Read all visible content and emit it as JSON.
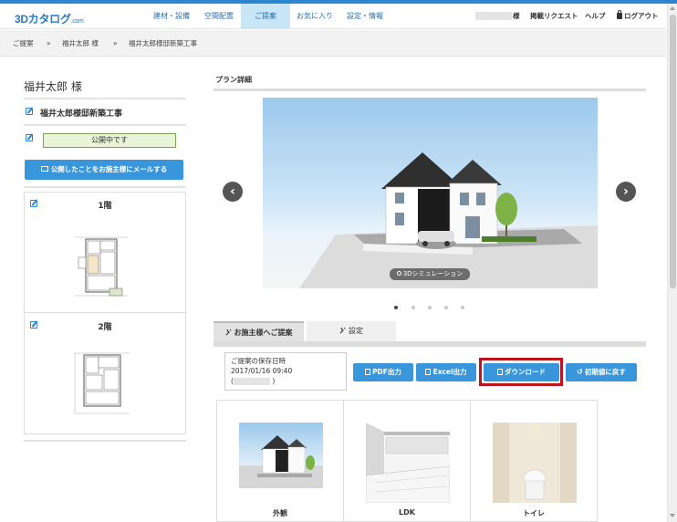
{
  "app": {
    "logo": "3Dカタログ",
    "logo_suffix": ".com"
  },
  "nav": {
    "items": [
      "建材・設備",
      "空間配置",
      "ご提案",
      "お気に入り",
      "設定・情報"
    ],
    "user_suffix": "様",
    "request": "掲載リクエスト",
    "help": "ヘルプ",
    "logout": "ログアウト"
  },
  "breadcrumb": {
    "items": [
      "ご提案",
      "福井太郎 様",
      "福井太郎様邸新築工事"
    ],
    "separator": "»"
  },
  "left": {
    "customer": "福井太郎 様",
    "project": "福井太郎様邸新築工事",
    "status": "公開中です",
    "mail_button": "公開したことをお施主様にメールする",
    "floors": [
      "1階",
      "2階"
    ]
  },
  "plan": {
    "heading": "プラン詳細",
    "sim_button": "3Dシミュレーション",
    "prev": "‹",
    "next": "›",
    "dot_count": 5
  },
  "tabs": {
    "proposal": "お施主様へご提案",
    "settings": "設定"
  },
  "save": {
    "label": "ご提案の保存日時",
    "date": "2017/01/16 09:40",
    "open": "(",
    "close": ")"
  },
  "actions": {
    "pdf": "PDF出力",
    "excel": "Excel出力",
    "download": "ダウンロード",
    "reset": "初期値に戻す"
  },
  "thumbs": [
    "外観",
    "LDK",
    "トイレ"
  ],
  "colors": {
    "accent": "#3a96db",
    "highlight": "#c0121b",
    "status_bg": "#e8f3d8"
  }
}
